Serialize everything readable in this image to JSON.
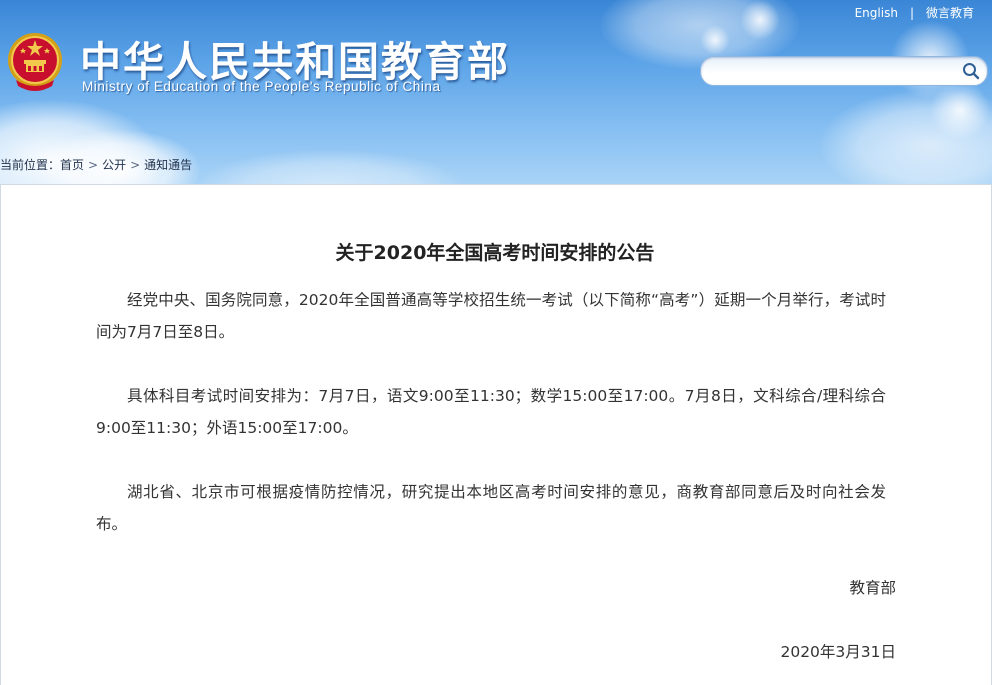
{
  "header": {
    "title_cn": "中华人民共和国教育部",
    "title_en": "Ministry of Education of the People's Republic of China",
    "links": {
      "english": "English",
      "separator": "|",
      "weibo": "微言教育"
    },
    "search": {
      "placeholder": "",
      "icon": "search-icon"
    },
    "emblem_icon": "national-emblem-icon",
    "colors": {
      "sky_top": "#3a86d6",
      "sky_bottom": "#a9d3f6"
    }
  },
  "breadcrumb": {
    "prefix": "当前位置：",
    "items": [
      "首页",
      "公开",
      "通知通告"
    ],
    "separator": ">"
  },
  "article": {
    "title": "关于2020年全国高考时间安排的公告",
    "paragraphs": [
      "经党中央、国务院同意，2020年全国普通高等学校招生统一考试（以下简称“高考”）延期一个月举行，考试时间为7月7日至8日。",
      "具体科目考试时间安排为：7月7日，语文9:00至11:30；数学15:00至17:00。7月8日，文科综合/理科综合9:00至11:30；外语15:00至17:00。",
      "湖北省、北京市可根据疫情防控情况，研究提出本地区高考时间安排的意见，商教育部同意后及时向社会发布。"
    ],
    "signature": "教育部",
    "date": "2020年3月31日"
  }
}
